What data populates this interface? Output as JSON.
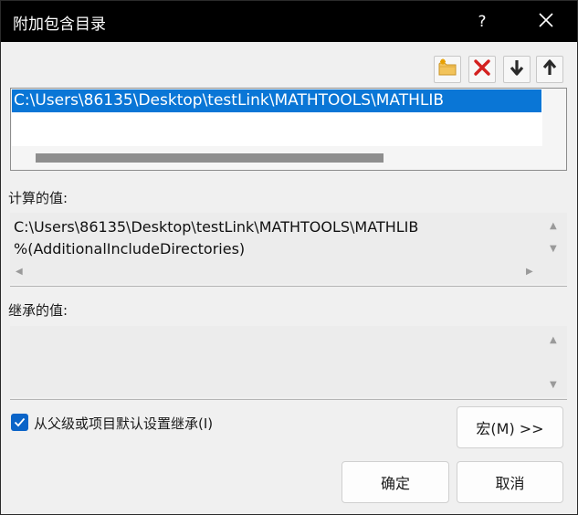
{
  "window": {
    "title": "附加包含目录",
    "help_label": "?"
  },
  "toolbar": {
    "icons": [
      "new-folder-icon",
      "delete-icon",
      "move-down-icon",
      "move-up-icon"
    ]
  },
  "list": {
    "items": [
      "C:\\Users\\86135\\Desktop\\testLink\\MATHTOOLS\\MATHLIB"
    ],
    "selected_index": 0
  },
  "computed": {
    "label": "计算的值:",
    "lines": [
      "C:\\Users\\86135\\Desktop\\testLink\\MATHTOOLS\\MATHLIB",
      "%(AdditionalIncludeDirectories)"
    ]
  },
  "inherited": {
    "label": "继承的值:",
    "lines": []
  },
  "options": {
    "inherit_label": "从父级或项目默认设置继承(I)",
    "inherit_checked": true
  },
  "buttons": {
    "macro": "宏(M) >>",
    "ok": "确定",
    "cancel": "取消"
  },
  "colors": {
    "selection": "#0a76d6",
    "checkbox": "#0a64c8",
    "titlebar": "#000000"
  }
}
